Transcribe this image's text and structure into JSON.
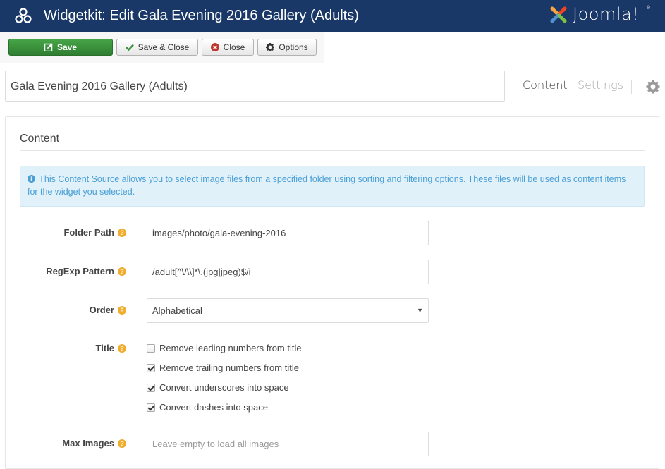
{
  "header": {
    "title": "Widgetkit: Edit Gala Evening 2016 Gallery (Adults)",
    "brand": "Joomla!",
    "brand_mark": "®"
  },
  "toolbar": {
    "save_label": "Save",
    "save_close_label": "Save & Close",
    "close_label": "Close",
    "options_label": "Options"
  },
  "widget_name": {
    "value": "Gala Evening 2016 Gallery (Adults)"
  },
  "tabs": [
    {
      "label": "Content",
      "active": true
    },
    {
      "label": "Settings",
      "active": false
    }
  ],
  "panel": {
    "title": "Content",
    "info_text": "This Content Source allows you to select image files from a specified folder using sorting and filtering options. These files will be used as content items for the widget you selected.",
    "fields": {
      "folder_path": {
        "label": "Folder Path",
        "value": "images/photo/gala-evening-2016"
      },
      "regexp": {
        "label": "RegExp Pattern",
        "value": "/adult[^\\/\\\\]*\\.(jpg|jpeg)$/i"
      },
      "order": {
        "label": "Order",
        "value": "Alphabetical"
      },
      "title": {
        "label": "Title",
        "options": [
          {
            "label": "Remove leading numbers from title",
            "checked": false
          },
          {
            "label": "Remove trailing numbers from title",
            "checked": true
          },
          {
            "label": "Convert underscores into space",
            "checked": true
          },
          {
            "label": "Convert dashes into space",
            "checked": true
          }
        ]
      },
      "max_images": {
        "label": "Max Images",
        "value": "",
        "placeholder": "Leave empty to load all images"
      }
    }
  },
  "colors": {
    "header_bg": "#1a3867",
    "save_green": "#3b953d",
    "info_bg": "#e0f1fa",
    "info_text": "#4a9fd5",
    "help_orange": "#f0ad2d"
  }
}
